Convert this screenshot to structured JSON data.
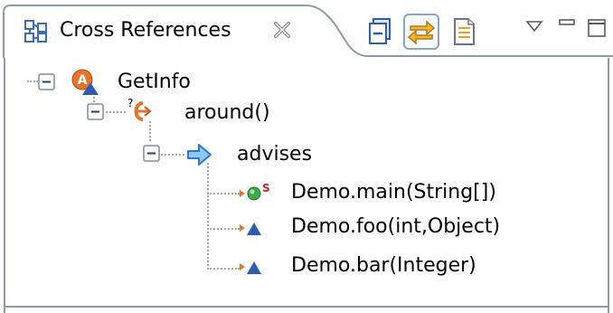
{
  "view": {
    "tab_title": "Cross References",
    "toolbar": {
      "collapse_all": "collapse-all-icon",
      "link_with_editor": "link-with-editor-icon",
      "show_details": "document-icon",
      "view_menu": "chevron-down-icon",
      "minimize": "minimize-icon",
      "maximize": "maximize-icon"
    },
    "colors": {
      "tab_border": "#8f9aa8",
      "toolbar_active_frame": "#8aa6c4",
      "aspect_orange": "#e8732a",
      "method_blue": "#2a5db0",
      "link_blue": "#3a8ee6",
      "main_green": "#3fa84a",
      "static_red": "#d0202a"
    }
  },
  "tree": {
    "root": {
      "label": "GetInfo",
      "icon": "aspect-icon"
    },
    "advice": {
      "label": "around()",
      "icon": "around-advice-icon"
    },
    "relationship": {
      "label": "advises",
      "icon": "arrow-right-icon"
    },
    "targets": [
      {
        "label": "Demo.main(String[])",
        "icon": "public-method-icon",
        "badge": "S"
      },
      {
        "label": "Demo.foo(int,Object)",
        "icon": "default-method-icon"
      },
      {
        "label": "Demo.bar(Integer)",
        "icon": "default-method-icon"
      }
    ]
  }
}
